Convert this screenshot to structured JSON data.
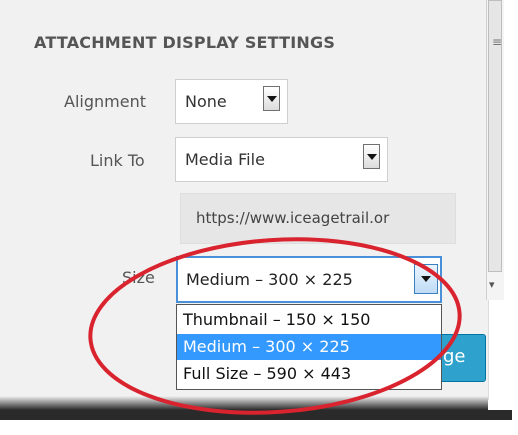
{
  "settings": {
    "heading": "ATTACHMENT DISPLAY SETTINGS",
    "alignment": {
      "label": "Alignment",
      "value": "None"
    },
    "link_to": {
      "label": "Link To",
      "value": "Media File"
    },
    "url": {
      "value": "https://www.iceagetrail.or"
    },
    "size": {
      "label": "Size",
      "value": "Medium – 300 × 225",
      "options": [
        "Thumbnail – 150 × 150",
        "Medium – 300 × 225",
        "Full Size – 590 × 443"
      ],
      "selected_index": 1
    }
  },
  "insert_button": {
    "label_fragment": "ge"
  },
  "colors": {
    "selection": "#3399ff",
    "annotation": "#d9232e",
    "button": "#2ea2cc"
  }
}
